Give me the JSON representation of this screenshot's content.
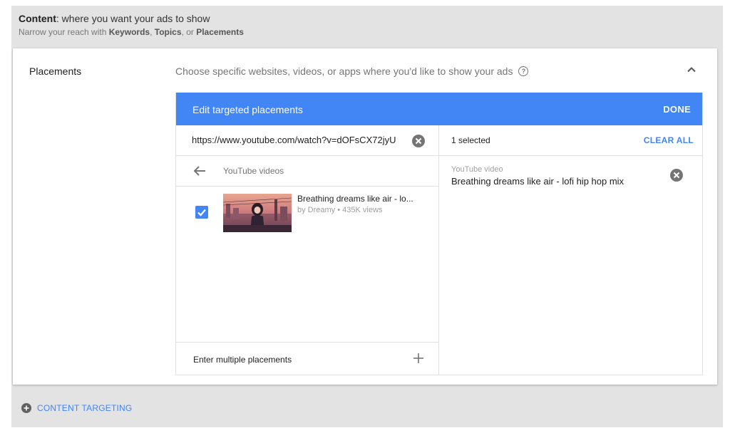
{
  "section": {
    "title_bold": "Content",
    "title_rest": ": where you want your ads to show",
    "subtitle_prefix": "Narrow your reach with ",
    "subtitle_k1": "Keywords",
    "subtitle_sep1": ", ",
    "subtitle_k2": "Topics",
    "subtitle_sep2": ", or ",
    "subtitle_k3": "Placements"
  },
  "card": {
    "label": "Placements",
    "description": "Choose specific websites, videos, or apps where you'd like to show your ads",
    "help_glyph": "?"
  },
  "editor": {
    "title": "Edit targeted placements",
    "done_label": "DONE",
    "search": {
      "value": "https://www.youtube.com/watch?v=dOFsCX72jyU"
    },
    "nav_label": "YouTube videos",
    "results": [
      {
        "title": "Breathing dreams like air - lo...",
        "meta": "by Dreamy • 435K views",
        "checked": true
      }
    ],
    "multi_label": "Enter multiple placements",
    "selected_count": "1 selected",
    "clear_all_label": "CLEAR ALL",
    "selected_items": [
      {
        "type": "YouTube video",
        "name": "Breathing dreams like air - lofi hip hop mix"
      }
    ]
  },
  "footer": {
    "content_targeting_label": "CONTENT TARGETING"
  },
  "colors": {
    "accent": "#4285f4",
    "background": "#e3e3e3"
  },
  "icons": [
    "help-icon",
    "chevron-up-icon",
    "clear-circle-icon",
    "arrow-left-icon",
    "checkbox-checked-icon",
    "plus-icon",
    "add-circle-icon"
  ]
}
